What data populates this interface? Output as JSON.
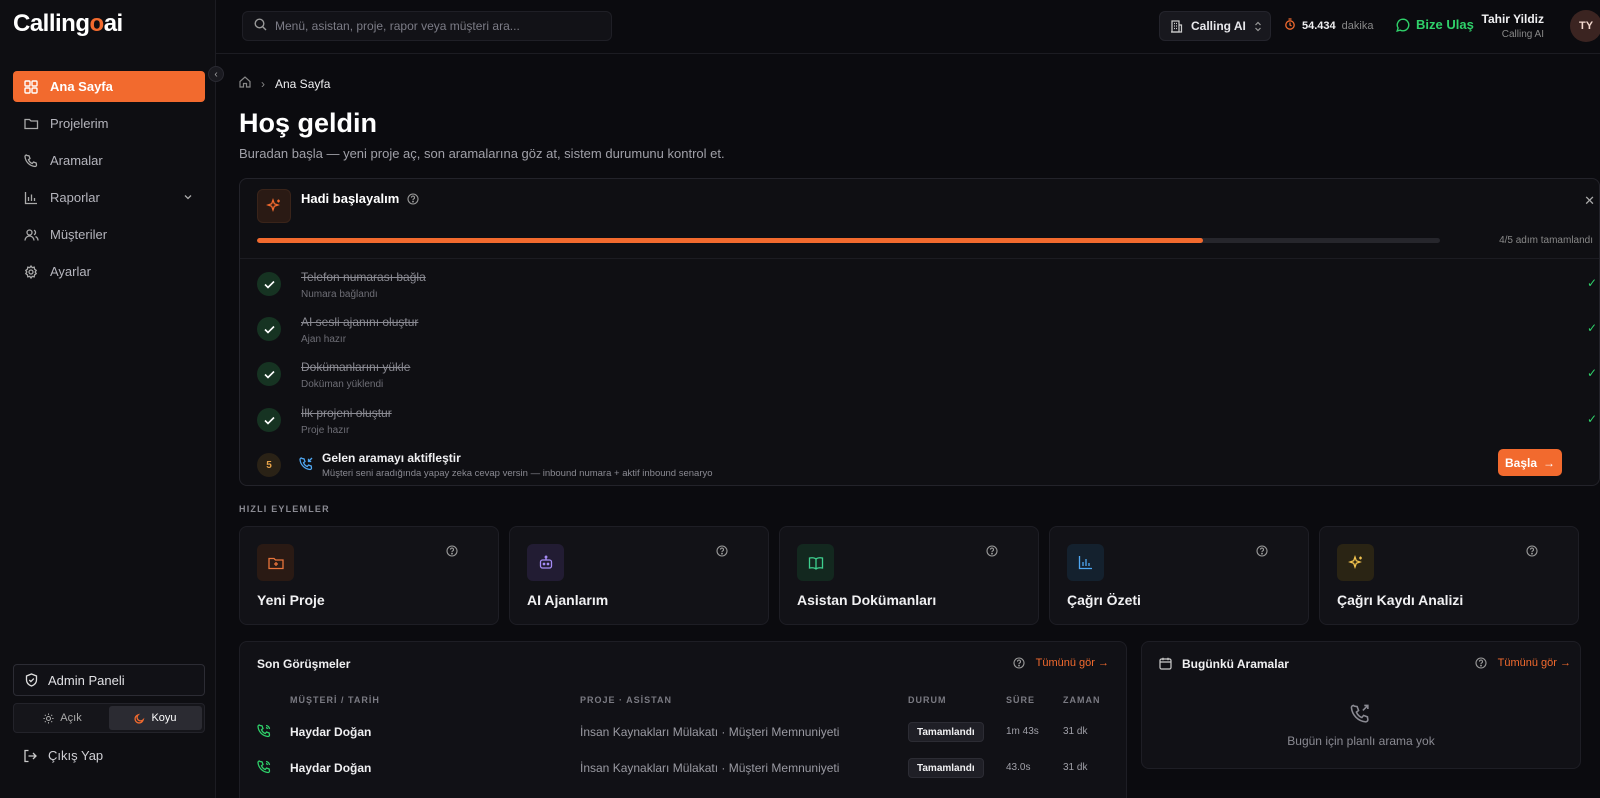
{
  "brand": {
    "logo_pre": "Calling",
    "logo_o": "o",
    "logo_post": "ai"
  },
  "sidebar": {
    "items": [
      {
        "label": "Ana Sayfa",
        "icon": "grid-icon",
        "active": true
      },
      {
        "label": "Projelerim",
        "icon": "folder-icon"
      },
      {
        "label": "Aramalar",
        "icon": "phone-icon"
      },
      {
        "label": "Raporlar",
        "icon": "bar-chart-icon",
        "expandable": true
      },
      {
        "label": "Müşteriler",
        "icon": "users-icon"
      },
      {
        "label": "Ayarlar",
        "icon": "gear-icon"
      }
    ],
    "admin_label": "Admin Paneli",
    "theme_light": "Açık",
    "theme_dark": "Koyu",
    "logout_label": "Çıkış Yap"
  },
  "topbar": {
    "search_placeholder": "Menü, asistan, proje, rapor veya müşteri ara...",
    "workspace": "Calling AI",
    "minutes_value": "54.434",
    "minutes_unit": "dakika",
    "contact_label": "Bize Ulaş",
    "user_name": "Tahir Yildiz",
    "user_org": "Calling AI",
    "avatar_initials": "TY"
  },
  "breadcrumb": {
    "current": "Ana Sayfa"
  },
  "page": {
    "title": "Hoş geldin",
    "subtitle": "Buradan başla — yeni proje aç, son aramalarına göz at, sistem durumunu kontrol et."
  },
  "getting_started": {
    "title": "Hadi başlayalım",
    "progress_fraction": 0.8,
    "progress_label": "4/5 adım tamamlandı",
    "steps": [
      {
        "title": "Telefon numarası bağla",
        "sub": "Numara bağlandı",
        "done": true
      },
      {
        "title": "AI sesli ajanını oluştur",
        "sub": "Ajan hazır",
        "done": true
      },
      {
        "title": "Dokümanlarını yükle",
        "sub": "Doküman yüklendi",
        "done": true
      },
      {
        "title": "İlk projeni oluştur",
        "sub": "Proje hazır",
        "done": true
      }
    ],
    "pending": {
      "number": "5",
      "title": "Gelen aramayı aktifleştir",
      "sub": "Müşteri seni aradığında yapay zeka cevap versin — inbound numara + aktif inbound senaryo",
      "button": "Başla"
    }
  },
  "quick_actions": {
    "label": "HIZLI EYLEMLER",
    "cards": [
      {
        "label": "Yeni Proje",
        "icon": "folder-plus-icon",
        "color": "#e8743b",
        "bg": "#2a1a14"
      },
      {
        "label": "AI Ajanlarım",
        "icon": "bot-icon",
        "color": "#a58bf5",
        "bg": "#221c33"
      },
      {
        "label": "Asistan Dokümanları",
        "icon": "book-icon",
        "color": "#3ecf8e",
        "bg": "#13281f"
      },
      {
        "label": "Çağrı Özeti",
        "icon": "chart-icon",
        "color": "#4fa7f2",
        "bg": "#14212e"
      },
      {
        "label": "Çağrı Kaydı Analizi",
        "icon": "sparkle-icon",
        "color": "#f2c34f",
        "bg": "#2a2414"
      }
    ]
  },
  "recent_calls": {
    "title": "Son Görüşmeler",
    "see_all": "Tümünü gör →",
    "columns": [
      "MÜŞTERİ / TARİH",
      "PROJE · ASİSTAN",
      "DURUM",
      "SÜRE",
      "ZAMAN"
    ],
    "rows": [
      {
        "name": "Haydar Doğan",
        "project": "İnsan Kaynakları Mülakatı · Müşteri Memnuniyeti",
        "status": "Tamamlandı",
        "duration": "1m 43s",
        "ago": "31 dk"
      },
      {
        "name": "Haydar Doğan",
        "project": "İnsan Kaynakları Mülakatı · Müşteri Memnuniyeti",
        "status": "Tamamlandı",
        "duration": "43.0s",
        "ago": "31 dk"
      }
    ]
  },
  "today_calls": {
    "title": "Bugünkü Aramalar",
    "see_all": "Tümünü gör →",
    "empty": "Bugün için planlı arama yok"
  },
  "colors": {
    "accent": "#f26a2e",
    "success": "#2fd16a",
    "background": "#0b0b0f"
  }
}
